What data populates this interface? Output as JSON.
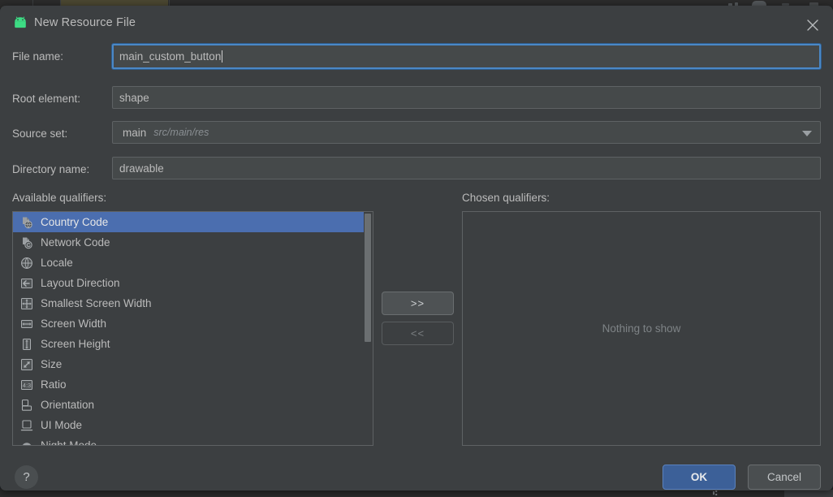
{
  "window": {
    "title": "New Resource File",
    "app_icon": "android-robot-icon",
    "close_icon": "close-icon"
  },
  "form": {
    "file_name": {
      "label": "File name:",
      "value": "main_custom_button",
      "focused": true
    },
    "root_element": {
      "label": "Root element:",
      "value": "shape"
    },
    "source_set": {
      "label": "Source set:",
      "value": "main",
      "path_hint": "src/main/res",
      "dropdown_icon": "chevron-down-icon"
    },
    "directory_name": {
      "label": "Directory name:",
      "value": "drawable"
    }
  },
  "qualifiers": {
    "available_caption": "Available qualifiers:",
    "chosen_caption": "Chosen qualifiers:",
    "empty_message": "Nothing to show",
    "selected_index": 0,
    "available": [
      {
        "label": "Country Code",
        "icon": "country-code-icon"
      },
      {
        "label": "Network Code",
        "icon": "network-code-icon"
      },
      {
        "label": "Locale",
        "icon": "globe-icon"
      },
      {
        "label": "Layout Direction",
        "icon": "arrow-left-icon"
      },
      {
        "label": "Smallest Screen Width",
        "icon": "resize-all-icon"
      },
      {
        "label": "Screen Width",
        "icon": "arrow-horizontal-icon"
      },
      {
        "label": "Screen Height",
        "icon": "arrow-vertical-icon"
      },
      {
        "label": "Size",
        "icon": "diagonal-arrow-icon"
      },
      {
        "label": "Ratio",
        "icon": "ratio-icon"
      },
      {
        "label": "Orientation",
        "icon": "orientation-icon"
      },
      {
        "label": "UI Mode",
        "icon": "ui-mode-icon"
      },
      {
        "label": "Night Mode",
        "icon": "night-mode-icon"
      }
    ],
    "add_button": ">>",
    "remove_button": "<<",
    "add_enabled": true,
    "remove_enabled": false
  },
  "footer": {
    "help_label": "?",
    "ok_label": "OK",
    "cancel_label": "Cancel"
  },
  "colors": {
    "dialog_background": "#3c3f41",
    "selection_blue": "#4b6eaf",
    "focus_border": "#4a88c7",
    "primary_button": "#3c6098",
    "android_green": "#3ddc84",
    "text": "#bbbbbb",
    "muted_text": "#7e8386"
  }
}
